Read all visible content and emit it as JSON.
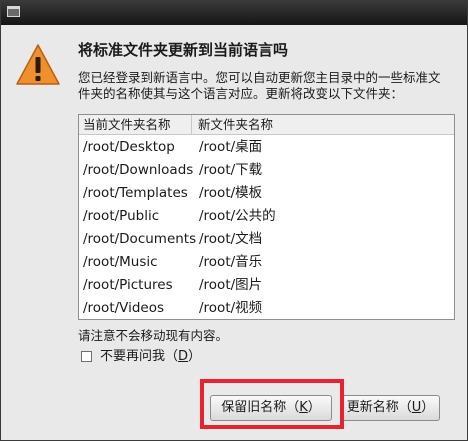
{
  "dialog": {
    "heading": "将标准文件夹更新到当前语言吗",
    "message_lines": [
      "您已经登录到新语言中。您可以自动更新您主目录中的一些标准文",
      "件夹的名称使其与这个语言对应。更新将改变以下文件夹："
    ],
    "table": {
      "headers": [
        "当前文件夹名称",
        "新文件夹名称"
      ],
      "rows": [
        {
          "current": "/root/Desktop",
          "new": "/root/桌面"
        },
        {
          "current": "/root/Downloads",
          "new": "/root/下载"
        },
        {
          "current": "/root/Templates",
          "new": "/root/模板"
        },
        {
          "current": "/root/Public",
          "new": "/root/公共的"
        },
        {
          "current": "/root/Documents",
          "new": "/root/文档"
        },
        {
          "current": "/root/Music",
          "new": "/root/音乐"
        },
        {
          "current": "/root/Pictures",
          "new": "/root/图片"
        },
        {
          "current": "/root/Videos",
          "new": "/root/视频"
        }
      ]
    },
    "note": "请注意不会移动现有内容。",
    "checkbox": {
      "label": "不要再问我（",
      "mnemonic": "D",
      "suffix": "）",
      "checked": false
    },
    "buttons": {
      "keep": {
        "label": "保留旧名称（",
        "mnemonic": "K",
        "suffix": "）"
      },
      "update": {
        "label": "更新名称（",
        "mnemonic": "U",
        "suffix": "）"
      }
    }
  },
  "colors": {
    "warning_fill": "#f0902c",
    "highlight_border": "#e8232f",
    "desktop_background": "#1f3b63"
  },
  "icons": {
    "window": "window-icon",
    "warning": "warning-icon"
  }
}
